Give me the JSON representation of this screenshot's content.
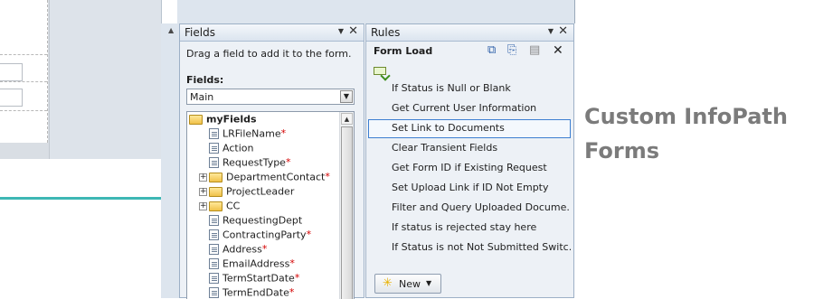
{
  "fields_pane": {
    "title": "Fields",
    "hint": "Drag a field to add it to the form.",
    "fields_label": "Fields:",
    "datasource": "Main",
    "tree": [
      {
        "label": "myFields",
        "type": "group",
        "expander": "",
        "required": false,
        "bold": true,
        "level": 0
      },
      {
        "label": "LRFileName",
        "type": "field",
        "expander": "",
        "required": true,
        "level": 1
      },
      {
        "label": "Action",
        "type": "field",
        "expander": "",
        "required": false,
        "level": 1
      },
      {
        "label": "RequestType",
        "type": "field",
        "expander": "",
        "required": true,
        "level": 1
      },
      {
        "label": "DepartmentContact",
        "type": "group",
        "expander": "+",
        "required": true,
        "level": 1
      },
      {
        "label": "ProjectLeader",
        "type": "group",
        "expander": "+",
        "required": false,
        "level": 1
      },
      {
        "label": "CC",
        "type": "group",
        "expander": "+",
        "required": false,
        "level": 1
      },
      {
        "label": "RequestingDept",
        "type": "field",
        "expander": "",
        "required": false,
        "level": 1
      },
      {
        "label": "ContractingParty",
        "type": "field",
        "expander": "",
        "required": true,
        "level": 1
      },
      {
        "label": "Address",
        "type": "field",
        "expander": "",
        "required": true,
        "level": 1
      },
      {
        "label": "EmailAddress",
        "type": "field",
        "expander": "",
        "required": true,
        "level": 1
      },
      {
        "label": "TermStartDate",
        "type": "field",
        "expander": "",
        "required": true,
        "level": 1
      },
      {
        "label": "TermEndDate",
        "type": "field",
        "expander": "",
        "required": true,
        "level": 1
      }
    ],
    "required_marker": "*"
  },
  "rules_pane": {
    "title": "Rules",
    "event": "Form Load",
    "rules": [
      {
        "label": "If Status is Null or Blank",
        "selected": false
      },
      {
        "label": "Get Current User Information",
        "selected": false
      },
      {
        "label": "Set Link to Documents",
        "selected": true
      },
      {
        "label": "Clear Transient Fields",
        "selected": false
      },
      {
        "label": "Get Form ID if Existing Request",
        "selected": false
      },
      {
        "label": "Set Upload Link if ID Not Empty",
        "selected": false
      },
      {
        "label": "Filter and Query Uploaded Docume...",
        "selected": false
      },
      {
        "label": "If status is rejected stay here",
        "selected": false
      },
      {
        "label": "If Status is not Not Submitted Switc...",
        "selected": false
      }
    ],
    "new_button": "New"
  },
  "icons": {
    "pane_menu": "chevron-down-icon",
    "pane_close": "close-icon",
    "copy": "copy-icon",
    "paste": "paste-icon",
    "clipboard": "clipboard-icon",
    "add_rule": "add-rule-icon",
    "new_star": "star-icon"
  },
  "colors": {
    "selection_border": "#3d7fd1",
    "required": "#d40000",
    "caption": "#7b7b7b",
    "accent_teal": "#3eb7b4"
  },
  "caption": {
    "line1": "Custom InfoPath",
    "line2": "Forms"
  }
}
